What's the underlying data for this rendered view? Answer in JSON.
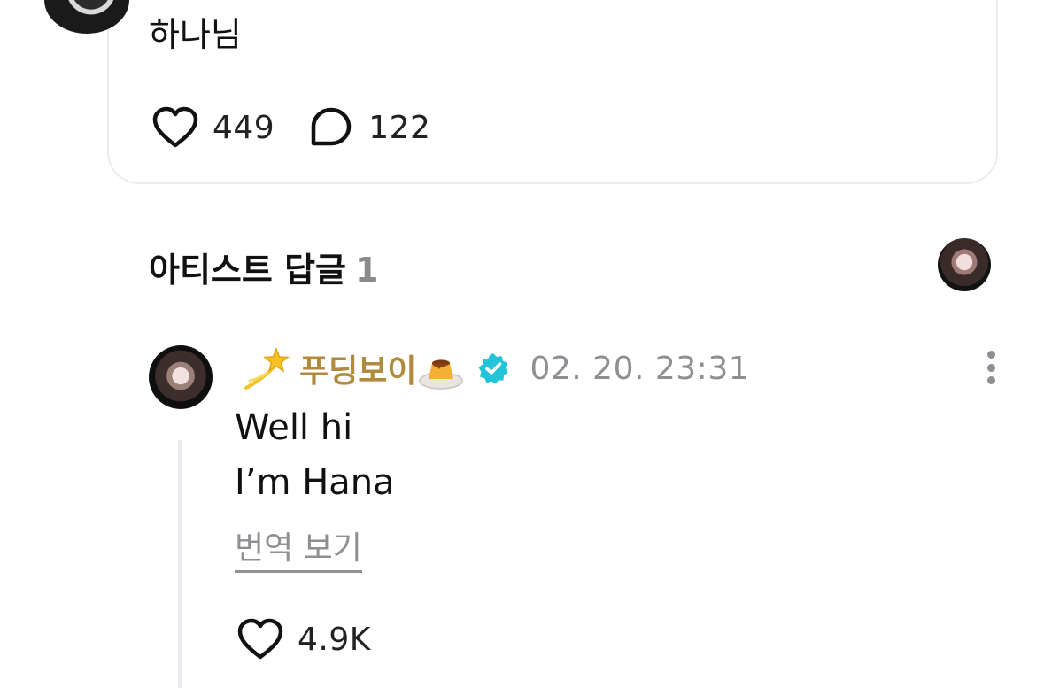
{
  "post": {
    "text": "하나님",
    "likes": "449",
    "comments": "122"
  },
  "artist_replies": {
    "title": "아티스트 답글",
    "count": "1"
  },
  "reply": {
    "username": "푸딩보이",
    "timestamp": "02. 20. 23:31",
    "line1": "Well hi",
    "line2": "I’m Hana",
    "translate_label": "번역 보기",
    "likes": "4.9K"
  },
  "colors": {
    "username": "#b08a3e",
    "verified": "#21c4d8",
    "muted": "#8e8e93"
  },
  "icons": {
    "like": "heart-outline-icon",
    "comment": "speech-bubble-icon",
    "verified": "verified-badge-icon",
    "more": "vertical-ellipsis-icon",
    "emoji_lead": "dizzy-star-emoji",
    "emoji_tail": "pudding-emoji"
  }
}
